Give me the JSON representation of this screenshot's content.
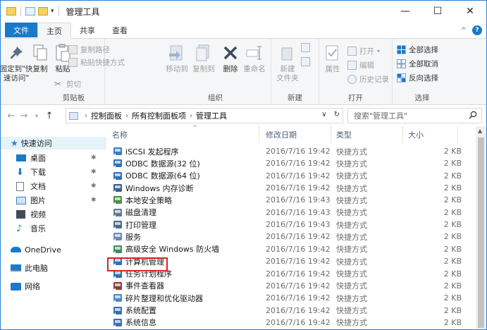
{
  "window": {
    "title": "管理工具",
    "controls": {
      "minimize": "—",
      "maximize": "☐",
      "close": "✕"
    }
  },
  "ribbon_tabs": {
    "file": "文件",
    "home": "主页",
    "share": "共享",
    "view": "查看"
  },
  "ribbon": {
    "clipboard": {
      "label": "剪贴板",
      "pin_quick_access": "固定到\"快\n速访问\"",
      "copy": "复制",
      "paste": "粘贴",
      "copy_path": "复制路径",
      "paste_shortcut": "粘贴快捷方式",
      "cut": "剪切"
    },
    "organize": {
      "label": "组织",
      "move_to": "移动到",
      "copy_to": "复制到",
      "delete": "删除",
      "rename": "重命名"
    },
    "new": {
      "label": "新建",
      "new_folder": "新建\n文件夹"
    },
    "open": {
      "label": "打开",
      "properties": "属性",
      "open": "打开",
      "edit": "编辑",
      "history": "历史记录"
    },
    "select": {
      "label": "选择",
      "select_all": "全部选择",
      "select_none": "全部取消",
      "invert": "反向选择"
    }
  },
  "address": {
    "crumbs": [
      "控制面板",
      "所有控制面板项",
      "管理工具"
    ],
    "search_placeholder": "搜索\"管理工具\""
  },
  "nav_pane": [
    {
      "label": "快速访问",
      "icon": "star-icon",
      "pinned": false
    },
    {
      "label": "桌面",
      "icon": "desktop-icon",
      "pinned": true
    },
    {
      "label": "下载",
      "icon": "download-icon",
      "pinned": true
    },
    {
      "label": "文档",
      "icon": "document-icon",
      "pinned": true
    },
    {
      "label": "图片",
      "icon": "pictures-icon",
      "pinned": true
    },
    {
      "label": "视频",
      "icon": "video-icon",
      "pinned": false
    },
    {
      "label": "音乐",
      "icon": "music-icon",
      "pinned": false
    },
    {
      "label": "OneDrive",
      "icon": "onedrive-icon",
      "pinned": false
    },
    {
      "label": "此电脑",
      "icon": "computer-icon",
      "pinned": false
    },
    {
      "label": "网络",
      "icon": "network-icon",
      "pinned": false
    }
  ],
  "columns": {
    "name": "名称",
    "date": "修改日期",
    "type": "类型",
    "size": "大小"
  },
  "files": [
    {
      "name": "iSCSI 发起程序",
      "date": "2016/7/16 19:42",
      "type": "快捷方式",
      "size": "2 KB",
      "icon": "iscsi-icon"
    },
    {
      "name": "ODBC 数据源(32 位)",
      "date": "2016/7/16 19:42",
      "type": "快捷方式",
      "size": "2 KB",
      "icon": "odbc-icon"
    },
    {
      "name": "ODBC 数据源(64 位)",
      "date": "2016/7/16 19:42",
      "type": "快捷方式",
      "size": "2 KB",
      "icon": "odbc-icon"
    },
    {
      "name": "Windows 内存诊断",
      "date": "2016/7/16 19:42",
      "type": "快捷方式",
      "size": "2 KB",
      "icon": "memory-diagnostic-icon"
    },
    {
      "name": "本地安全策略",
      "date": "2016/7/16 19:43",
      "type": "快捷方式",
      "size": "2 KB",
      "icon": "security-policy-icon"
    },
    {
      "name": "磁盘清理",
      "date": "2016/7/16 19:43",
      "type": "快捷方式",
      "size": "2 KB",
      "icon": "disk-cleanup-icon"
    },
    {
      "name": "打印管理",
      "date": "2016/7/16 19:43",
      "type": "快捷方式",
      "size": "2 KB",
      "icon": "print-management-icon"
    },
    {
      "name": "服务",
      "date": "2016/7/16 19:42",
      "type": "快捷方式",
      "size": "2 KB",
      "icon": "services-icon"
    },
    {
      "name": "高级安全 Windows 防火墙",
      "date": "2016/7/16 19:42",
      "type": "快捷方式",
      "size": "2 KB",
      "icon": "firewall-icon"
    },
    {
      "name": "计算机管理",
      "date": "2016/7/16 19:42",
      "type": "快捷方式",
      "size": "2 KB",
      "icon": "computer-management-icon"
    },
    {
      "name": "任务计划程序",
      "date": "2016/7/16 19:42",
      "type": "快捷方式",
      "size": "2 KB",
      "icon": "task-scheduler-icon"
    },
    {
      "name": "事件查看器",
      "date": "2016/7/16 19:42",
      "type": "快捷方式",
      "size": "2 KB",
      "icon": "event-viewer-icon"
    },
    {
      "name": "碎片整理和优化驱动器",
      "date": "2016/7/16 19:42",
      "type": "快捷方式",
      "size": "2 KB",
      "icon": "defrag-icon"
    },
    {
      "name": "系统配置",
      "date": "2016/7/16 19:42",
      "type": "快捷方式",
      "size": "2 KB",
      "icon": "system-config-icon"
    },
    {
      "name": "系统信息",
      "date": "2016/7/16 19:42",
      "type": "快捷方式",
      "size": "2 KB",
      "icon": "system-info-icon"
    }
  ],
  "highlight_row": 9,
  "colors": {
    "accent": "#1979ca",
    "highlight": "#e02020",
    "quick_access_bg": "#e5f3fb",
    "folder": "#f4d35e"
  }
}
